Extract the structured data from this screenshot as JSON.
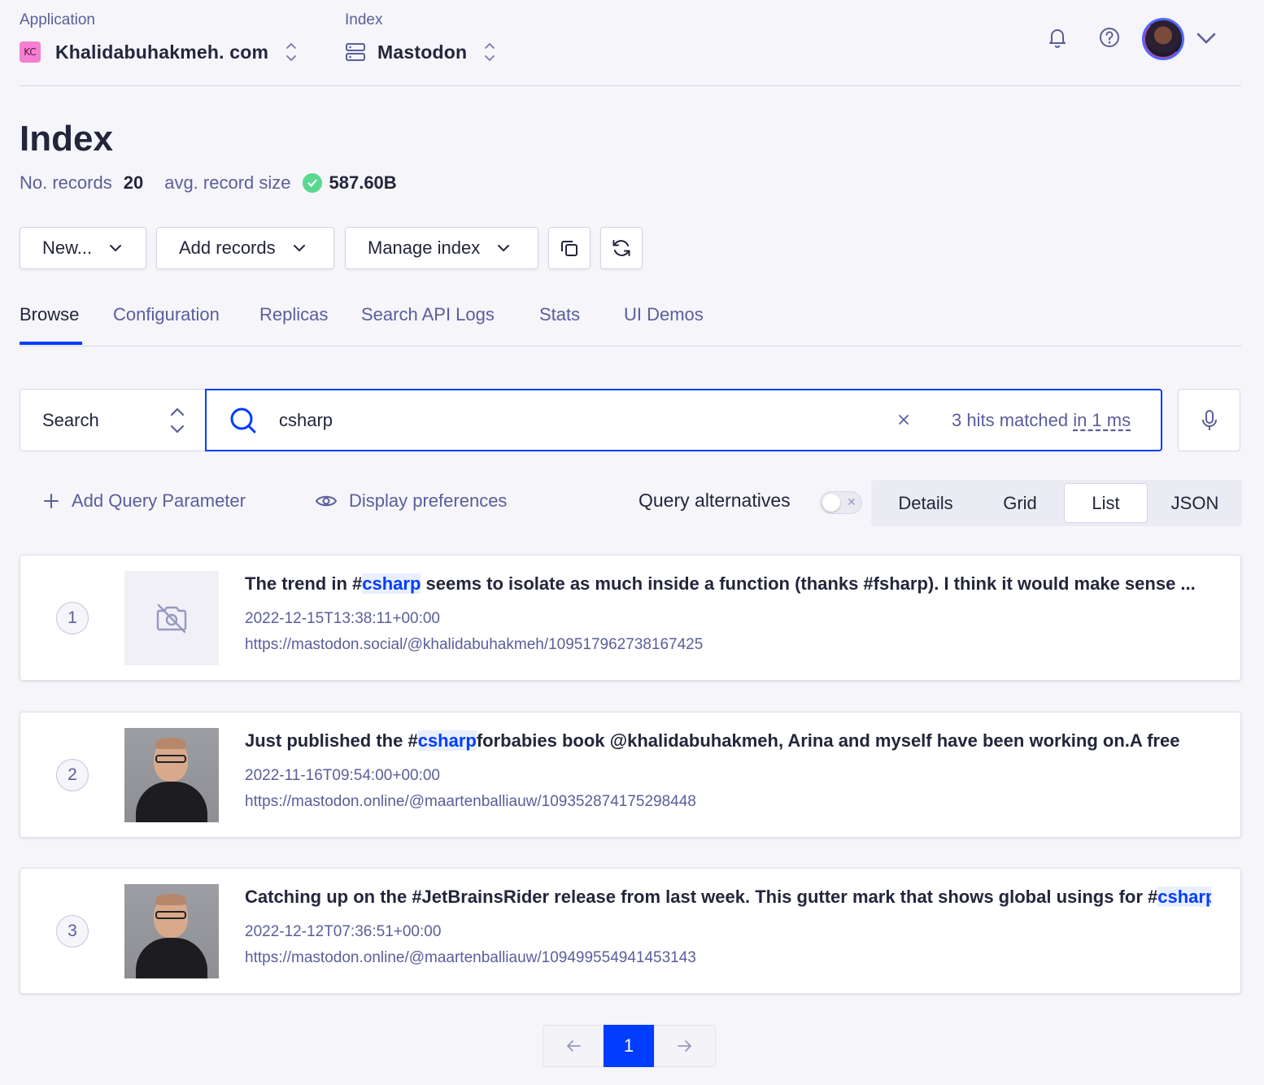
{
  "topbar": {
    "application_label": "Application",
    "application_badge": "KC",
    "application_value": "Khalidabuhakmeh. com",
    "index_label": "Index",
    "index_value": "Mastodon",
    "icons": [
      "bell-icon",
      "help-icon",
      "avatar",
      "chevron-down-icon"
    ]
  },
  "header": {
    "title": "Index",
    "records_label": "No. records",
    "records_value": "20",
    "size_label": "avg. record size",
    "size_value": "587.60B"
  },
  "actions": {
    "new_label": "New...",
    "add_records_label": "Add records",
    "manage_index_label": "Manage index"
  },
  "tabs": [
    {
      "label": "Browse",
      "active": true
    },
    {
      "label": "Configuration"
    },
    {
      "label": "Replicas"
    },
    {
      "label": "Search API Logs"
    },
    {
      "label": "Stats"
    },
    {
      "label": "UI Demos"
    }
  ],
  "search": {
    "mode_label": "Search",
    "query": "csharp",
    "hits_prefix": "3 hits matched ",
    "hits_time": "in 1 ms"
  },
  "toolbar": {
    "add_query_parameter": "Add Query Parameter",
    "display_preferences": "Display preferences",
    "query_alternatives": "Query alternatives",
    "query_alternatives_on": false,
    "views": [
      "Details",
      "Grid",
      "List",
      "JSON"
    ],
    "active_view": "List"
  },
  "results": [
    {
      "rank": "1",
      "title_before": "The trend in #",
      "title_highlight": "csharp",
      "title_after": " seems to isolate as much inside a function (thanks #fsharp). I think it would make sense ...",
      "date": "2022-12-15T13:38:11+00:00",
      "url": "https://mastodon.social/@khalidabuhakmeh/109517962738167425",
      "image": "no-image-icon"
    },
    {
      "rank": "2",
      "title_before": "Just published the #",
      "title_highlight": "csharp",
      "title_after": "forbabies book @khalidabuhakmeh, Arina and myself have been working on.A free",
      "date": "2022-11-16T09:54:00+00:00",
      "url": "https://mastodon.online/@maartenballiauw/109352874175298448",
      "image": "profile-photo"
    },
    {
      "rank": "3",
      "title_before": "Catching up on the #JetBrainsRider release from last week. This gutter mark that shows global usings for #",
      "title_highlight": "csharp",
      "title_after": "",
      "date": "2022-12-12T07:36:51+00:00",
      "url": "https://mastodon.online/@maartenballiauw/109499554941453143",
      "image": "profile-photo"
    }
  ],
  "pagination": {
    "current_page": "1",
    "prev_icon": "arrow-left-icon",
    "next_icon": "arrow-right-icon"
  },
  "colors": {
    "accent": "#003dff",
    "muted_text": "#5a5e9a",
    "text": "#23263b",
    "success": "#5ad88f",
    "badge": "#f57fd1"
  }
}
